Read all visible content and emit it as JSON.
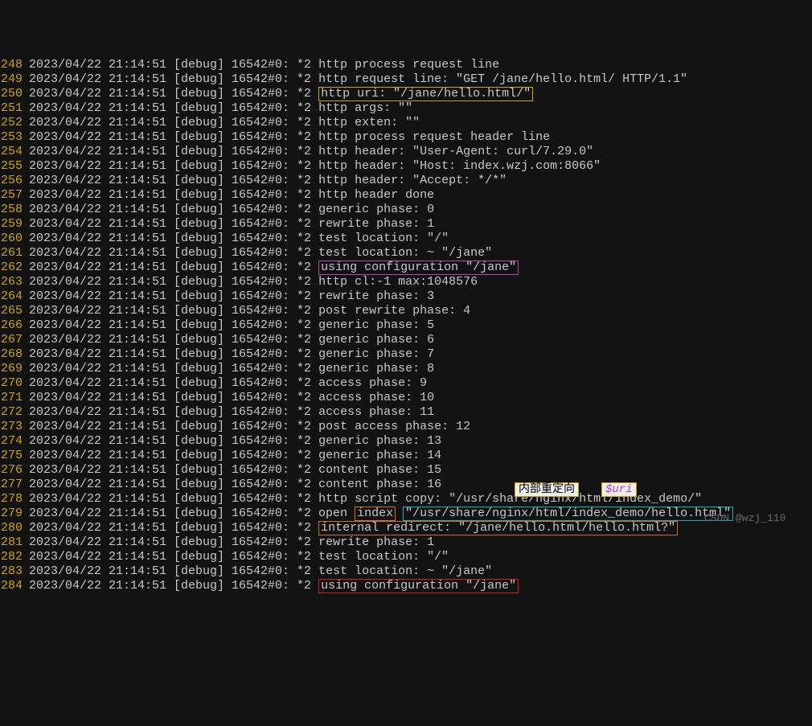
{
  "prefix": "2023/04/22 21:14:51 [debug] 16542#0: *2 ",
  "lines": [
    {
      "n": 248,
      "pre": "",
      "segs": [
        {
          "t": "http process request line"
        }
      ]
    },
    {
      "n": 249,
      "pre": "",
      "segs": [
        {
          "t": "http request line: \"GET /jane/hello.html/ HTTP/1.1\""
        }
      ]
    },
    {
      "n": 250,
      "pre": "",
      "segs": [
        {
          "t": "http uri: \"/jane/hello.html/\"",
          "box": "box-yellow"
        }
      ]
    },
    {
      "n": 251,
      "pre": "",
      "segs": [
        {
          "t": "http args: \"\""
        }
      ]
    },
    {
      "n": 252,
      "pre": "",
      "segs": [
        {
          "t": "http exten: \"\""
        }
      ]
    },
    {
      "n": 253,
      "pre": "",
      "segs": [
        {
          "t": "http process request header line"
        }
      ]
    },
    {
      "n": 254,
      "pre": "",
      "segs": [
        {
          "t": "http header: \"User-Agent: curl/7.29.0\""
        }
      ]
    },
    {
      "n": 255,
      "pre": "",
      "segs": [
        {
          "t": "http header: \"Host: index.wzj.com:8066\""
        }
      ]
    },
    {
      "n": 256,
      "pre": "",
      "segs": [
        {
          "t": "http header: \"Accept: */*\""
        }
      ]
    },
    {
      "n": 257,
      "pre": "",
      "segs": [
        {
          "t": "http header done"
        }
      ]
    },
    {
      "n": 258,
      "pre": "",
      "segs": [
        {
          "t": "generic phase: 0"
        }
      ]
    },
    {
      "n": 259,
      "pre": "",
      "segs": [
        {
          "t": "rewrite phase: 1"
        }
      ]
    },
    {
      "n": 260,
      "pre": "",
      "segs": [
        {
          "t": "test location: \"/\""
        }
      ]
    },
    {
      "n": 261,
      "pre": "",
      "segs": [
        {
          "t": "test location: ~ \"/jane\""
        }
      ]
    },
    {
      "n": 262,
      "pre": "",
      "segs": [
        {
          "t": "using configuration \"/jane\"",
          "box": "box-magenta"
        }
      ]
    },
    {
      "n": 263,
      "pre": "",
      "segs": [
        {
          "t": "http cl:-1 max:1048576"
        }
      ]
    },
    {
      "n": 264,
      "pre": "",
      "segs": [
        {
          "t": "rewrite phase: 3"
        }
      ]
    },
    {
      "n": 265,
      "pre": "",
      "segs": [
        {
          "t": "post rewrite phase: 4"
        }
      ]
    },
    {
      "n": 266,
      "pre": "",
      "segs": [
        {
          "t": "generic phase: 5"
        }
      ]
    },
    {
      "n": 267,
      "pre": "",
      "segs": [
        {
          "t": "generic phase: 6"
        }
      ]
    },
    {
      "n": 268,
      "pre": "",
      "segs": [
        {
          "t": "generic phase: 7"
        }
      ]
    },
    {
      "n": 269,
      "pre": "",
      "segs": [
        {
          "t": "generic phase: 8"
        }
      ]
    },
    {
      "n": 270,
      "pre": "",
      "segs": [
        {
          "t": "access phase: 9"
        }
      ]
    },
    {
      "n": 271,
      "pre": "",
      "segs": [
        {
          "t": "access phase: 10"
        }
      ]
    },
    {
      "n": 272,
      "pre": "",
      "segs": [
        {
          "t": "access phase: 11"
        }
      ]
    },
    {
      "n": 273,
      "pre": "",
      "segs": [
        {
          "t": "post access phase: 12"
        }
      ]
    },
    {
      "n": 274,
      "pre": "",
      "segs": [
        {
          "t": "generic phase: 13"
        }
      ]
    },
    {
      "n": 275,
      "pre": "",
      "segs": [
        {
          "t": "generic phase: 14"
        }
      ]
    },
    {
      "n": 276,
      "pre": "",
      "segs": [
        {
          "t": "content phase: 15"
        }
      ]
    },
    {
      "n": 277,
      "pre": "",
      "segs": [
        {
          "t": "content phase: 16"
        }
      ]
    },
    {
      "n": 278,
      "pre": "",
      "segs": [
        {
          "t": "http script copy: \"/usr/share/nginx/html/index_demo/\""
        }
      ]
    },
    {
      "n": 279,
      "pre": "open ",
      "segs": [
        {
          "t": "index",
          "box": "box-orange"
        },
        {
          "t": " "
        },
        {
          "t": "\"/usr/share/nginx/html/index_demo/hello.html\"",
          "box": "box-cyan"
        }
      ]
    },
    {
      "n": 280,
      "pre": "",
      "segs": [
        {
          "t": "internal redirect: \"/jane/hello.html/hello.html?\"",
          "box": "box-orange"
        }
      ]
    },
    {
      "n": 281,
      "pre": "",
      "segs": [
        {
          "t": "rewrite phase: 1"
        }
      ]
    },
    {
      "n": 282,
      "pre": "",
      "segs": [
        {
          "t": "test location: \"/\""
        }
      ]
    },
    {
      "n": 283,
      "pre": "",
      "segs": [
        {
          "t": "test location: ~ \"/jane\""
        }
      ]
    },
    {
      "n": 284,
      "pre": "",
      "segs": [
        {
          "t": "using configuration \"/jane\"",
          "box": "box-red"
        }
      ]
    }
  ],
  "annotations": {
    "note1": "内部重定向",
    "note2": "$uri"
  },
  "watermark": "CSDN @wzj_110"
}
